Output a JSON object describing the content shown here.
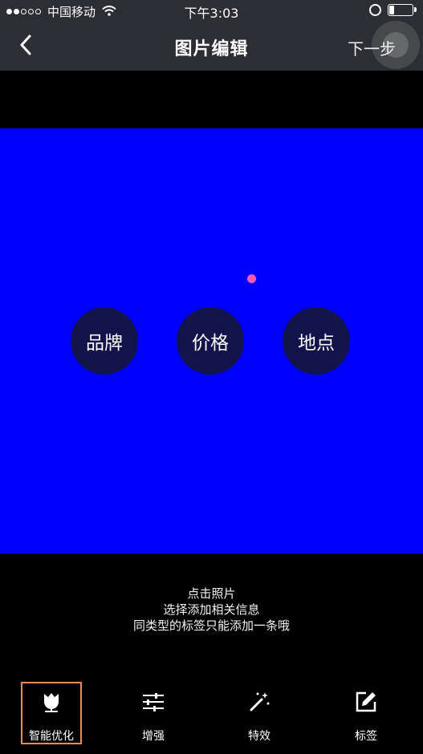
{
  "status_bar": {
    "carrier": "中国移动",
    "time": "下午3:03"
  },
  "nav": {
    "title": "图片编辑",
    "next_label": "下一步"
  },
  "photo": {
    "background_color": "#0000fe",
    "tag_options": [
      {
        "label": "品牌"
      },
      {
        "label": "价格"
      },
      {
        "label": "地点"
      }
    ]
  },
  "hint": {
    "line1": "点击照片",
    "line2": "选择添加相关信息",
    "line3": "同类型的标签只能添加一条哦"
  },
  "toolbar": {
    "items": [
      {
        "label": "智能优化",
        "icon": "tulip-icon",
        "selected": true
      },
      {
        "label": "增强",
        "icon": "sliders-icon",
        "selected": false
      },
      {
        "label": "特效",
        "icon": "magic-wand-icon",
        "selected": false
      },
      {
        "label": "标签",
        "icon": "edit-icon",
        "selected": false
      }
    ]
  }
}
